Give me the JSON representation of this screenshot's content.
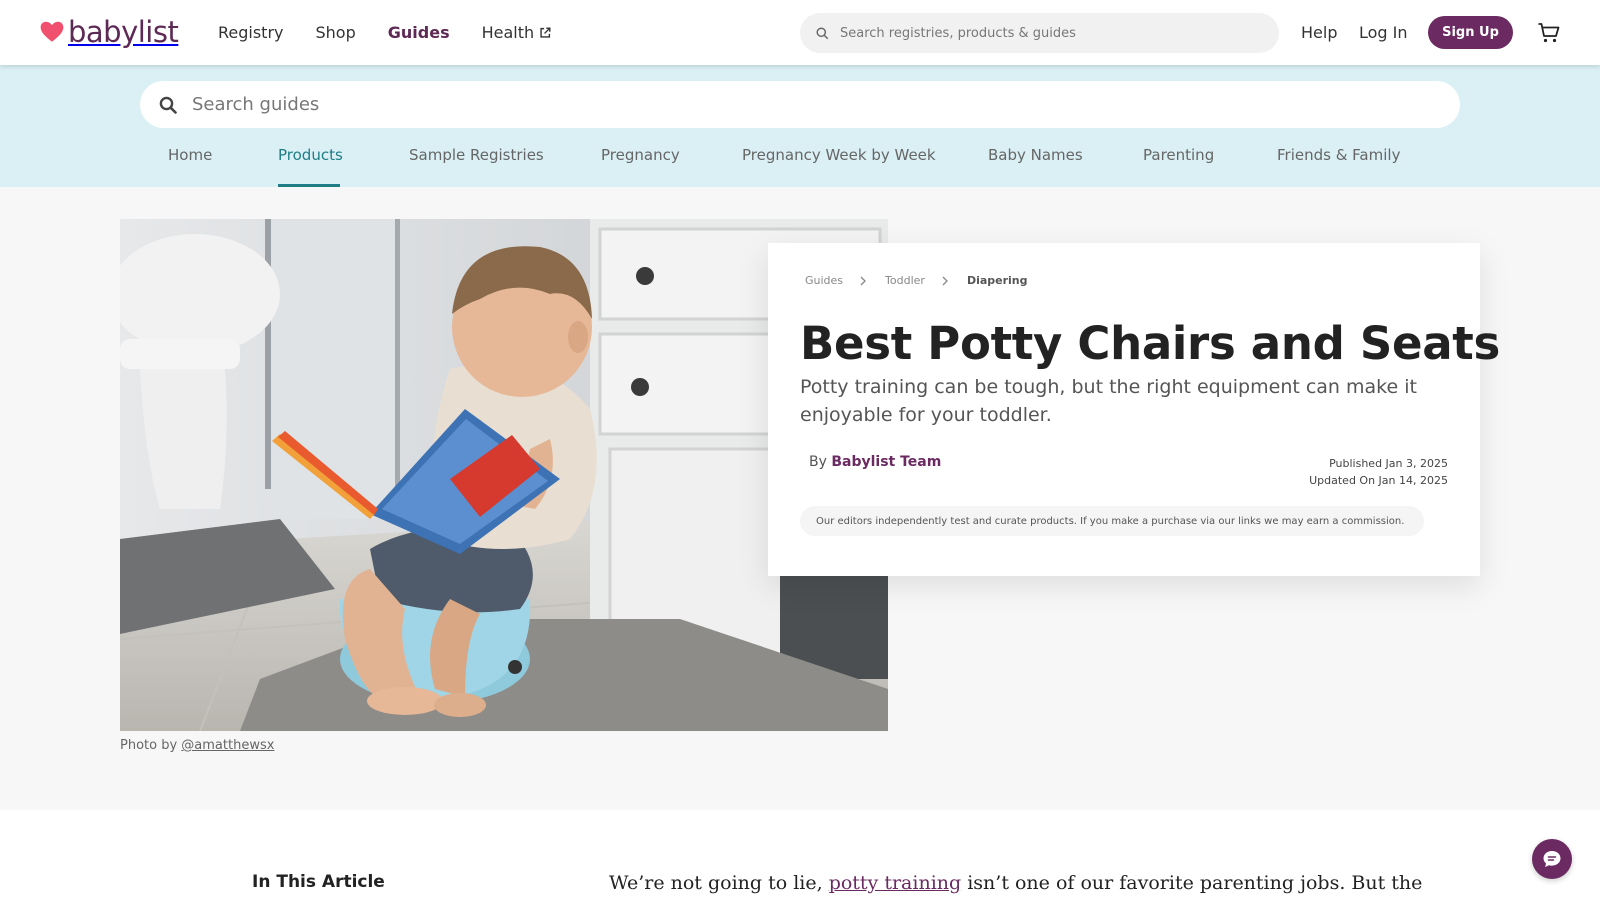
{
  "header": {
    "brand": "babylist",
    "nav": [
      {
        "label": "Registry"
      },
      {
        "label": "Shop"
      },
      {
        "label": "Guides"
      },
      {
        "label": "Health"
      }
    ],
    "search_placeholder": "Search registries, products & guides",
    "help_label": "Help",
    "login_label": "Log In",
    "signup_label": "Sign Up",
    "cart_icon": "cart-icon"
  },
  "guides_bar": {
    "search_placeholder": "Search guides",
    "categories": [
      {
        "label": "Home"
      },
      {
        "label": "Products"
      },
      {
        "label": "Sample Registries"
      },
      {
        "label": "Pregnancy"
      },
      {
        "label": "Pregnancy Week by Week"
      },
      {
        "label": "Baby Names"
      },
      {
        "label": "Parenting"
      },
      {
        "label": "Friends & Family"
      }
    ],
    "active_category": "Products"
  },
  "hero": {
    "photo_credit_prefix": "Photo by ",
    "photo_credit_handle": "@amatthewsx",
    "breadcrumbs": [
      "Guides",
      "Toddler",
      "Diapering"
    ],
    "title": "Best Potty Chairs and Seats",
    "subtitle": "Potty training can be tough, but the right equipment can make it enjoyable for your toddler.",
    "byline_prefix": "By",
    "author": "Babylist Team",
    "published": "Published Jan 3, 2025",
    "updated": "Updated On Jan 14, 2025",
    "disclaimer": "Our editors independently test and curate products. If you make a purchase via our links we may earn a commission."
  },
  "article": {
    "toc_title": "In This Article",
    "intro_before": "We’re not going to lie, ",
    "intro_link": "potty training",
    "intro_after": " isn’t one of our favorite parenting jobs. But the"
  },
  "colors": {
    "brand": "#6b2a62",
    "heart": "#f0506e",
    "guides_bar_bg": "#daf0f5",
    "active_tab": "#1f7d86"
  }
}
